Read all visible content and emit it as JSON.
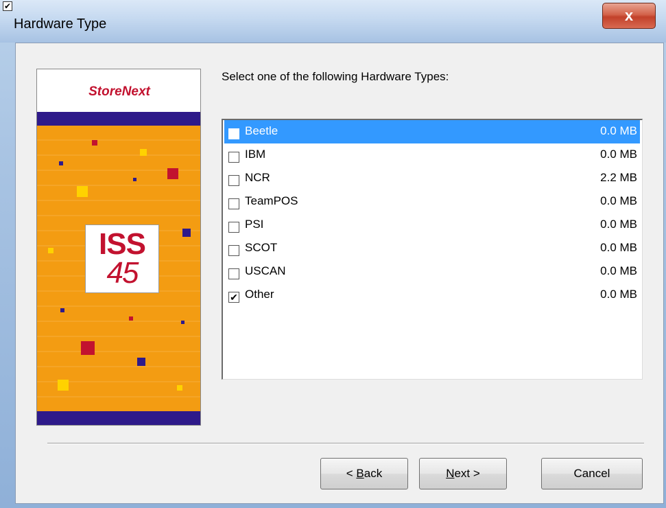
{
  "window": {
    "title": "Hardware Type",
    "title_checkbox": "✔",
    "close_glyph": "x"
  },
  "banner": {
    "brand": "StoreNext",
    "logo_line1": "ISS",
    "logo_line2": "45",
    "colors": {
      "orange": "#f39c12",
      "navy": "#2e1a8a",
      "red": "#c2122f",
      "yellow": "#ffd200"
    }
  },
  "prompt": "Select one of the following Hardware Types:",
  "hardware_types": [
    {
      "label": "Beetle",
      "size": "0.0 MB",
      "checked": false,
      "selected": true
    },
    {
      "label": "IBM",
      "size": "0.0 MB",
      "checked": false,
      "selected": false
    },
    {
      "label": "NCR",
      "size": "2.2 MB",
      "checked": false,
      "selected": false
    },
    {
      "label": "TeamPOS",
      "size": "0.0 MB",
      "checked": false,
      "selected": false
    },
    {
      "label": "PSI",
      "size": "0.0 MB",
      "checked": false,
      "selected": false
    },
    {
      "label": "SCOT",
      "size": "0.0 MB",
      "checked": false,
      "selected": false
    },
    {
      "label": "USCAN",
      "size": "0.0 MB",
      "checked": false,
      "selected": false
    },
    {
      "label": "Other",
      "size": "0.0 MB",
      "checked": true,
      "selected": false
    }
  ],
  "buttons": {
    "back_prefix": "< ",
    "back_mnemonic": "B",
    "back_rest": "ack",
    "next_mnemonic": "N",
    "next_rest": "ext >",
    "cancel": "Cancel"
  },
  "icons": {
    "checkmark": "✔"
  }
}
